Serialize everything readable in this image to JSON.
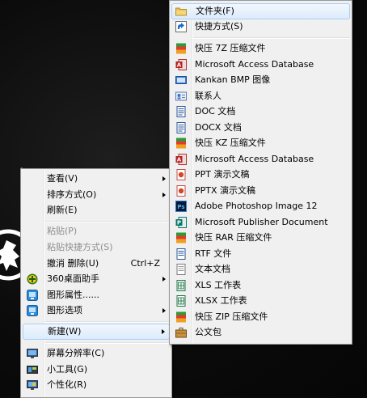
{
  "colors": {
    "menu_bg": "#f0f0f0",
    "hover_top": "#f2f7fd",
    "hover_bottom": "#dcebfc",
    "hover_border": "#a8cff7",
    "disabled_text": "#8d8d8d"
  },
  "context_menu": {
    "items": [
      {
        "label": "查看(V)",
        "icon": "",
        "submenu": true
      },
      {
        "label": "排序方式(O)",
        "icon": "",
        "submenu": true
      },
      {
        "label": "刷新(E)",
        "icon": ""
      },
      {
        "label": "粘贴(P)",
        "icon": "",
        "disabled": true
      },
      {
        "label": "粘贴快捷方式(S)",
        "icon": "",
        "disabled": true
      },
      {
        "label": "撤消 删除(U)",
        "shortcut": "Ctrl+Z",
        "icon": ""
      },
      {
        "label": "360桌面助手",
        "icon": "360-plus-icon",
        "submenu": true
      },
      {
        "label": "图形属性......",
        "icon": "graphics-properties-icon"
      },
      {
        "label": "图形选项",
        "icon": "graphics-options-icon",
        "submenu": true
      },
      {
        "label": "新建(W)",
        "icon": "",
        "submenu": true,
        "highlighted": true
      },
      {
        "label": "屏幕分辨率(C)",
        "icon": "screen-resolution-icon"
      },
      {
        "label": "小工具(G)",
        "icon": "gadgets-icon"
      },
      {
        "label": "个性化(R)",
        "icon": "personalize-icon"
      }
    ]
  },
  "new_submenu": {
    "items": [
      {
        "label": "文件夹(F)",
        "icon": "folder-icon",
        "highlighted": true
      },
      {
        "label": "快捷方式(S)",
        "icon": "shortcut-icon"
      },
      {
        "label": "快压 7Z 压缩文件",
        "icon": "archive-7z-icon"
      },
      {
        "label": "Microsoft Access Database",
        "icon": "access-icon"
      },
      {
        "label": "Kankan BMP 图像",
        "icon": "bmp-image-icon"
      },
      {
        "label": "联系人",
        "icon": "contact-icon"
      },
      {
        "label": "DOC 文档",
        "icon": "doc-icon"
      },
      {
        "label": "DOCX 文档",
        "icon": "docx-icon"
      },
      {
        "label": "快压 KZ 压缩文件",
        "icon": "archive-kz-icon"
      },
      {
        "label": "Microsoft Access Database",
        "icon": "access-icon"
      },
      {
        "label": "PPT 演示文稿",
        "icon": "ppt-icon"
      },
      {
        "label": "PPTX 演示文稿",
        "icon": "pptx-icon"
      },
      {
        "label": "Adobe Photoshop Image 12",
        "icon": "photoshop-icon"
      },
      {
        "label": "Microsoft Publisher Document",
        "icon": "publisher-icon"
      },
      {
        "label": "快压 RAR 压缩文件",
        "icon": "archive-rar-icon"
      },
      {
        "label": "RTF 文件",
        "icon": "rtf-icon"
      },
      {
        "label": "文本文档",
        "icon": "text-document-icon"
      },
      {
        "label": "XLS 工作表",
        "icon": "xls-icon"
      },
      {
        "label": "XLSX 工作表",
        "icon": "xlsx-icon"
      },
      {
        "label": "快压 ZIP 压缩文件",
        "icon": "archive-zip-icon"
      },
      {
        "label": "公文包",
        "icon": "briefcase-icon"
      }
    ]
  }
}
